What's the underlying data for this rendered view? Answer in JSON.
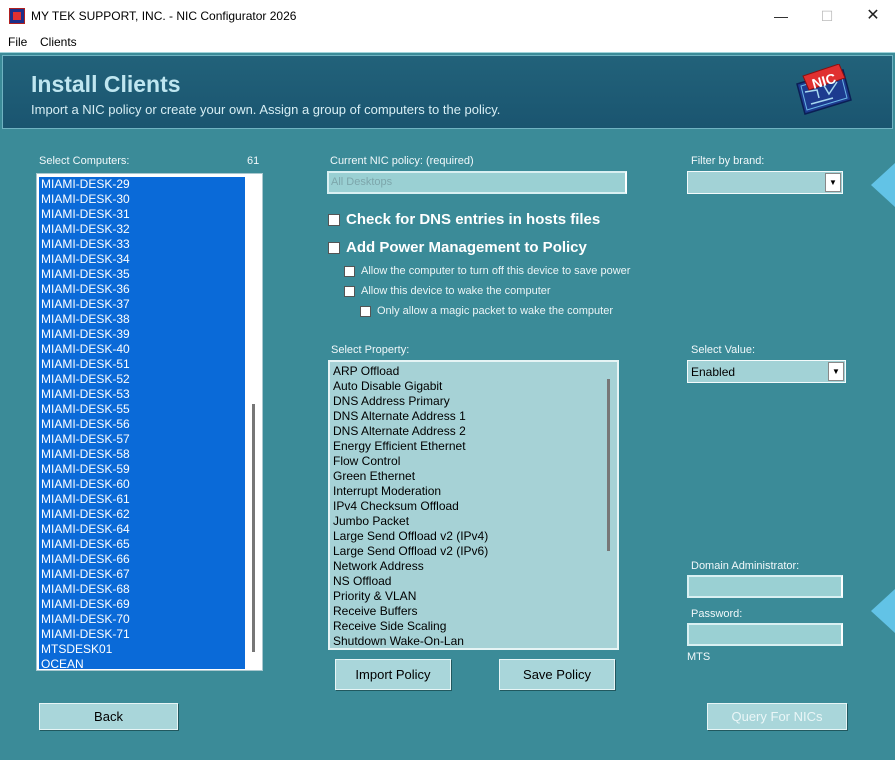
{
  "window": {
    "title": "MY TEK SUPPORT, INC. - NIC Configurator 2026",
    "minimize": "—",
    "maximize": "☐",
    "close": "✕"
  },
  "menu": {
    "file": "File",
    "clients": "Clients"
  },
  "header": {
    "title": "Install Clients",
    "subtitle": "Import a NIC policy or create your own.  Assign a group of computers to the policy.",
    "logo_text": "NIC"
  },
  "computers": {
    "label": "Select Computers:",
    "count": "61",
    "items": [
      "MIAMI-DESK-29",
      "MIAMI-DESK-30",
      "MIAMI-DESK-31",
      "MIAMI-DESK-32",
      "MIAMI-DESK-33",
      "MIAMI-DESK-34",
      "MIAMI-DESK-35",
      "MIAMI-DESK-36",
      "MIAMI-DESK-37",
      "MIAMI-DESK-38",
      "MIAMI-DESK-39",
      "MIAMI-DESK-40",
      "MIAMI-DESK-51",
      "MIAMI-DESK-52",
      "MIAMI-DESK-53",
      "MIAMI-DESK-55",
      "MIAMI-DESK-56",
      "MIAMI-DESK-57",
      "MIAMI-DESK-58",
      "MIAMI-DESK-59",
      "MIAMI-DESK-60",
      "MIAMI-DESK-61",
      "MIAMI-DESK-62",
      "MIAMI-DESK-64",
      "MIAMI-DESK-65",
      "MIAMI-DESK-66",
      "MIAMI-DESK-67",
      "MIAMI-DESK-68",
      "MIAMI-DESK-69",
      "MIAMI-DESK-70",
      "MIAMI-DESK-71",
      "MTSDESK01",
      "OCEAN"
    ]
  },
  "policy": {
    "label": "Current NIC policy: (required)",
    "value": "All Desktops"
  },
  "filter": {
    "label": "Filter by brand:",
    "value": ""
  },
  "checks": {
    "dns": "Check for DNS entries in hosts files",
    "power": "Add Power Management to Policy",
    "turn_off": "Allow the computer to turn off this device to save power",
    "wake": "Allow this device to wake the computer",
    "magic": "Only allow a magic packet to wake the computer"
  },
  "property": {
    "label": "Select Property:",
    "items": [
      "ARP Offload",
      "Auto Disable Gigabit",
      "DNS Address Primary",
      "DNS Alternate Address 1",
      "DNS Alternate Address 2",
      "Energy Efficient Ethernet",
      "Flow Control",
      "Green Ethernet",
      "Interrupt Moderation",
      "IPv4 Checksum Offload",
      "Jumbo Packet",
      "Large Send Offload v2 (IPv4)",
      "Large Send Offload v2 (IPv6)",
      "Network Address",
      "NS Offload",
      "Priority & VLAN",
      "Receive Buffers",
      "Receive Side Scaling",
      "Shutdown Wake-On-Lan"
    ]
  },
  "value": {
    "label": "Select Value:",
    "selected": "Enabled"
  },
  "admin": {
    "label": "Domain Administrator:",
    "value": ""
  },
  "password": {
    "label": "Password:",
    "value": "",
    "domain": "MTS"
  },
  "buttons": {
    "import": "Import Policy",
    "save": "Save Policy",
    "back": "Back",
    "query": "Query For NICs"
  },
  "colors": {
    "background": "#3b8b98",
    "header": "#1a5570",
    "selection": "#0a6ad8",
    "field": "#a6d2d6"
  }
}
